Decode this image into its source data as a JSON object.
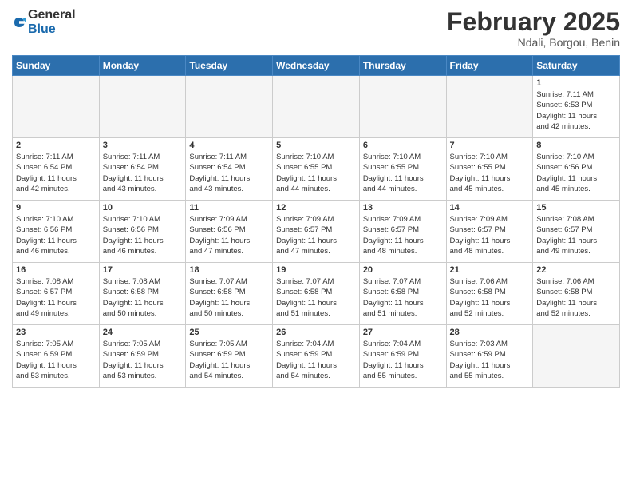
{
  "logo": {
    "general": "General",
    "blue": "Blue"
  },
  "header": {
    "month": "February 2025",
    "location": "Ndali, Borgou, Benin"
  },
  "weekdays": [
    "Sunday",
    "Monday",
    "Tuesday",
    "Wednesday",
    "Thursday",
    "Friday",
    "Saturday"
  ],
  "weeks": [
    [
      {
        "day": "",
        "info": ""
      },
      {
        "day": "",
        "info": ""
      },
      {
        "day": "",
        "info": ""
      },
      {
        "day": "",
        "info": ""
      },
      {
        "day": "",
        "info": ""
      },
      {
        "day": "",
        "info": ""
      },
      {
        "day": "1",
        "info": "Sunrise: 7:11 AM\nSunset: 6:53 PM\nDaylight: 11 hours\nand 42 minutes."
      }
    ],
    [
      {
        "day": "2",
        "info": "Sunrise: 7:11 AM\nSunset: 6:54 PM\nDaylight: 11 hours\nand 42 minutes."
      },
      {
        "day": "3",
        "info": "Sunrise: 7:11 AM\nSunset: 6:54 PM\nDaylight: 11 hours\nand 43 minutes."
      },
      {
        "day": "4",
        "info": "Sunrise: 7:11 AM\nSunset: 6:54 PM\nDaylight: 11 hours\nand 43 minutes."
      },
      {
        "day": "5",
        "info": "Sunrise: 7:10 AM\nSunset: 6:55 PM\nDaylight: 11 hours\nand 44 minutes."
      },
      {
        "day": "6",
        "info": "Sunrise: 7:10 AM\nSunset: 6:55 PM\nDaylight: 11 hours\nand 44 minutes."
      },
      {
        "day": "7",
        "info": "Sunrise: 7:10 AM\nSunset: 6:55 PM\nDaylight: 11 hours\nand 45 minutes."
      },
      {
        "day": "8",
        "info": "Sunrise: 7:10 AM\nSunset: 6:56 PM\nDaylight: 11 hours\nand 45 minutes."
      }
    ],
    [
      {
        "day": "9",
        "info": "Sunrise: 7:10 AM\nSunset: 6:56 PM\nDaylight: 11 hours\nand 46 minutes."
      },
      {
        "day": "10",
        "info": "Sunrise: 7:10 AM\nSunset: 6:56 PM\nDaylight: 11 hours\nand 46 minutes."
      },
      {
        "day": "11",
        "info": "Sunrise: 7:09 AM\nSunset: 6:56 PM\nDaylight: 11 hours\nand 47 minutes."
      },
      {
        "day": "12",
        "info": "Sunrise: 7:09 AM\nSunset: 6:57 PM\nDaylight: 11 hours\nand 47 minutes."
      },
      {
        "day": "13",
        "info": "Sunrise: 7:09 AM\nSunset: 6:57 PM\nDaylight: 11 hours\nand 48 minutes."
      },
      {
        "day": "14",
        "info": "Sunrise: 7:09 AM\nSunset: 6:57 PM\nDaylight: 11 hours\nand 48 minutes."
      },
      {
        "day": "15",
        "info": "Sunrise: 7:08 AM\nSunset: 6:57 PM\nDaylight: 11 hours\nand 49 minutes."
      }
    ],
    [
      {
        "day": "16",
        "info": "Sunrise: 7:08 AM\nSunset: 6:57 PM\nDaylight: 11 hours\nand 49 minutes."
      },
      {
        "day": "17",
        "info": "Sunrise: 7:08 AM\nSunset: 6:58 PM\nDaylight: 11 hours\nand 50 minutes."
      },
      {
        "day": "18",
        "info": "Sunrise: 7:07 AM\nSunset: 6:58 PM\nDaylight: 11 hours\nand 50 minutes."
      },
      {
        "day": "19",
        "info": "Sunrise: 7:07 AM\nSunset: 6:58 PM\nDaylight: 11 hours\nand 51 minutes."
      },
      {
        "day": "20",
        "info": "Sunrise: 7:07 AM\nSunset: 6:58 PM\nDaylight: 11 hours\nand 51 minutes."
      },
      {
        "day": "21",
        "info": "Sunrise: 7:06 AM\nSunset: 6:58 PM\nDaylight: 11 hours\nand 52 minutes."
      },
      {
        "day": "22",
        "info": "Sunrise: 7:06 AM\nSunset: 6:58 PM\nDaylight: 11 hours\nand 52 minutes."
      }
    ],
    [
      {
        "day": "23",
        "info": "Sunrise: 7:05 AM\nSunset: 6:59 PM\nDaylight: 11 hours\nand 53 minutes."
      },
      {
        "day": "24",
        "info": "Sunrise: 7:05 AM\nSunset: 6:59 PM\nDaylight: 11 hours\nand 53 minutes."
      },
      {
        "day": "25",
        "info": "Sunrise: 7:05 AM\nSunset: 6:59 PM\nDaylight: 11 hours\nand 54 minutes."
      },
      {
        "day": "26",
        "info": "Sunrise: 7:04 AM\nSunset: 6:59 PM\nDaylight: 11 hours\nand 54 minutes."
      },
      {
        "day": "27",
        "info": "Sunrise: 7:04 AM\nSunset: 6:59 PM\nDaylight: 11 hours\nand 55 minutes."
      },
      {
        "day": "28",
        "info": "Sunrise: 7:03 AM\nSunset: 6:59 PM\nDaylight: 11 hours\nand 55 minutes."
      },
      {
        "day": "",
        "info": ""
      }
    ]
  ]
}
